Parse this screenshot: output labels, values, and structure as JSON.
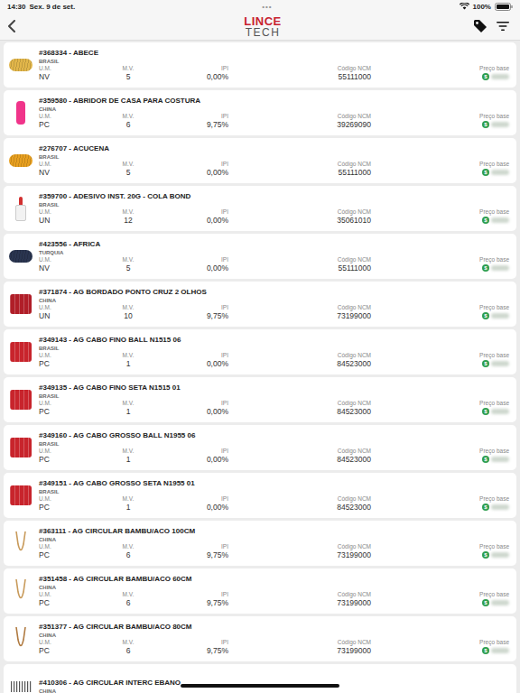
{
  "status_bar": {
    "time": "14:30",
    "date": "Sex. 9 de set.",
    "dots": "•••",
    "battery": "100%"
  },
  "header": {
    "logo_top": "LINCE",
    "logo_bottom": "TECH"
  },
  "columns": [
    "U.M.",
    "M.V.",
    "IPI",
    "Código NCM",
    "Preço base"
  ],
  "price_icon": "$",
  "rows": [
    {
      "title": "#368334 - ABECE",
      "origin": "BRASIL",
      "um": "NV",
      "mv": "5",
      "ipi": "0,00%",
      "ncm": "55111000",
      "kind": "yarn",
      "color": "#e2b64a"
    },
    {
      "title": "#359580 - ABRIDOR DE CASA PARA COSTURA",
      "origin": "CHINA",
      "um": "PC",
      "mv": "6",
      "ipi": "9,75%",
      "ncm": "39269090",
      "kind": "opener",
      "color": "#f0348a"
    },
    {
      "title": "#276707 - ACUCENA",
      "origin": "BRASIL",
      "um": "NV",
      "mv": "5",
      "ipi": "0,00%",
      "ncm": "55111000",
      "kind": "yarn",
      "color": "#e8a020"
    },
    {
      "title": "#359700 - ADESIVO INST. 20G - COLA BOND",
      "origin": "BRASIL",
      "um": "UN",
      "mv": "12",
      "ipi": "0,00%",
      "ncm": "35061010",
      "kind": "bottle",
      "color": "#d23030"
    },
    {
      "title": "#423556 - AFRICA",
      "origin": "TURQUIA",
      "um": "NV",
      "mv": "5",
      "ipi": "0,00%",
      "ncm": "55111000",
      "kind": "yarn",
      "color": "#2a3550"
    },
    {
      "title": "#371874 - AG BORDADO PONTO CRUZ 2 OLHOS",
      "origin": "CHINA",
      "um": "UN",
      "mv": "10",
      "ipi": "9,75%",
      "ncm": "73199000",
      "kind": "pack",
      "color": "#b01e28"
    },
    {
      "title": "#349143 - AG CABO FINO BALL N1515 06",
      "origin": "BRASIL",
      "um": "PC",
      "mv": "1",
      "ipi": "0,00%",
      "ncm": "84523000",
      "kind": "pack",
      "color": "#c8242c"
    },
    {
      "title": "#349135 - AG CABO FINO SETA N1515 01",
      "origin": "BRASIL",
      "um": "PC",
      "mv": "1",
      "ipi": "0,00%",
      "ncm": "84523000",
      "kind": "pack",
      "color": "#c8242c"
    },
    {
      "title": "#349160 - AG CABO GROSSO BALL N1955 06",
      "origin": "BRASIL",
      "um": "PC",
      "mv": "1",
      "ipi": "0,00%",
      "ncm": "84523000",
      "kind": "pack",
      "color": "#c8242c"
    },
    {
      "title": "#349151 - AG CABO GROSSO SETA N1955 01",
      "origin": "BRASIL",
      "um": "PC",
      "mv": "1",
      "ipi": "0,00%",
      "ncm": "84523000",
      "kind": "pack",
      "color": "#c8242c"
    },
    {
      "title": "#363111 - AG CIRCULAR BAMBU/ACO 100CM",
      "origin": "CHINA",
      "um": "PC",
      "mv": "6",
      "ipi": "9,75%",
      "ncm": "73199000",
      "kind": "needle",
      "color": "#c89a5a"
    },
    {
      "title": "#351458 - AG CIRCULAR BAMBU/ACO 60CM",
      "origin": "CHINA",
      "um": "PC",
      "mv": "6",
      "ipi": "9,75%",
      "ncm": "73199000",
      "kind": "needle",
      "color": "#c89a5a"
    },
    {
      "title": "#351377 - AG CIRCULAR BAMBU/ACO 80CM",
      "origin": "CHINA",
      "um": "PC",
      "mv": "6",
      "ipi": "9,75%",
      "ncm": "73199000",
      "kind": "needle",
      "color": "#b07a40"
    },
    {
      "title": "#410306 - AG CIRCULAR INTERC EBANO",
      "origin": "CHINA",
      "kind": "pins",
      "color": "#555555"
    }
  ]
}
